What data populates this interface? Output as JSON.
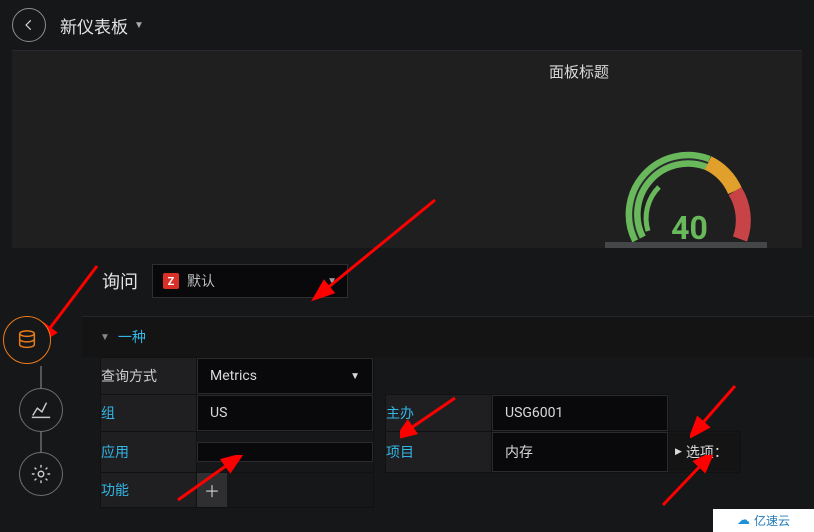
{
  "nav": {
    "dashboard_title": "新仪表板"
  },
  "panel": {
    "title": "面板标题"
  },
  "chart_data": {
    "type": "gauge",
    "value": 40,
    "min": 0,
    "max": 100,
    "thresholds": [
      0,
      67,
      90,
      100
    ],
    "colors": [
      "#69b85b",
      "#e0a02b",
      "#c74345"
    ],
    "title": "面板标题"
  },
  "query": {
    "label": "询问",
    "datasource_badge": "Z",
    "datasource_name": "默认",
    "collapse_label": "一种"
  },
  "form": {
    "query_mode_label": "查询方式",
    "query_mode_value": "Metrics",
    "group_label": "组",
    "group_value": "US",
    "host_label": "主办",
    "host_value": "USG6001",
    "app_label": "应用",
    "app_value": "",
    "item_label": "项目",
    "item_value": "内存",
    "options_label": "选项：",
    "functions_label": "功能"
  },
  "watermark": {
    "text": "亿速云"
  }
}
